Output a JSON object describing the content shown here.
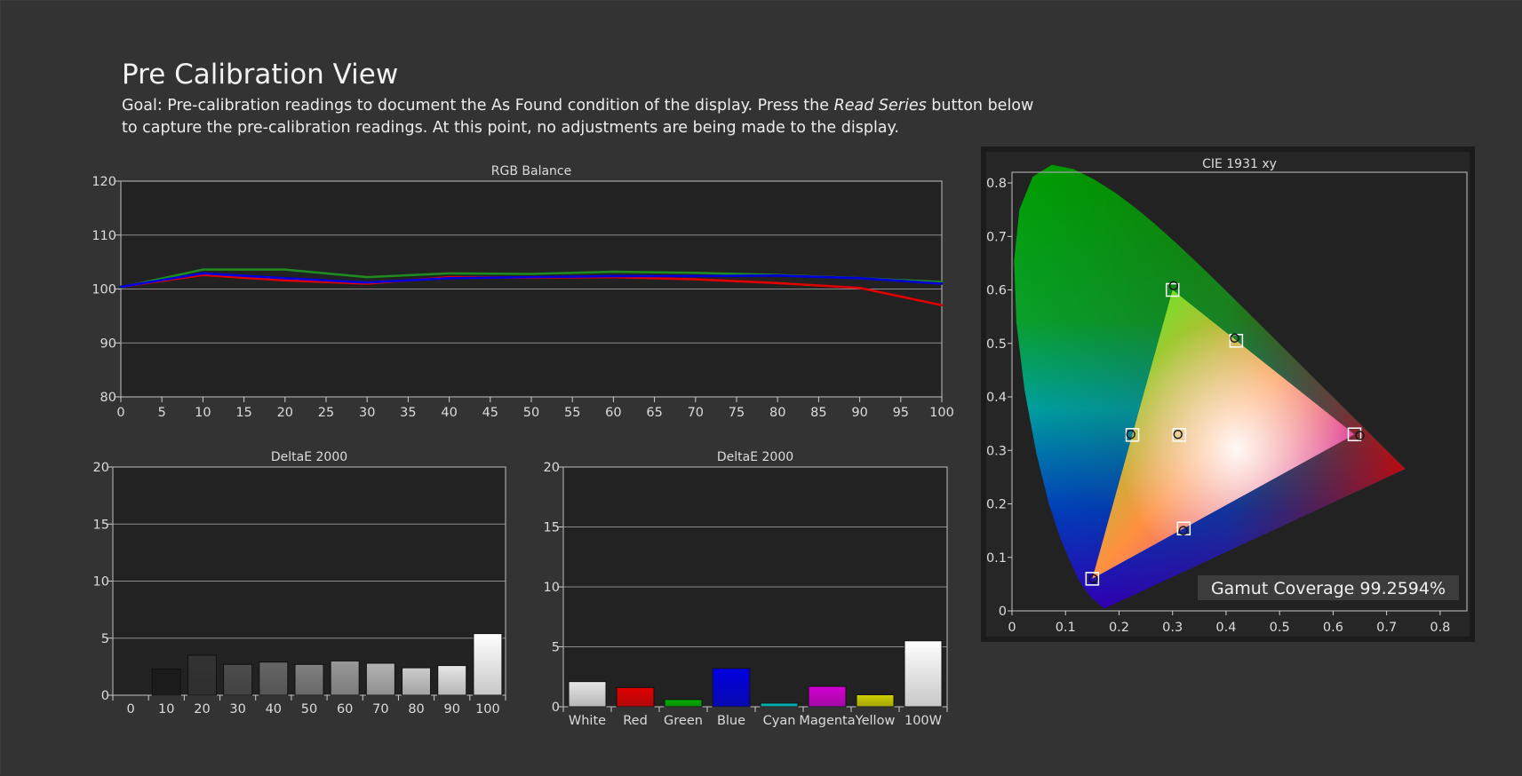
{
  "header": {
    "title": "Pre Calibration View",
    "goal_pre": "Goal: Pre-calibration readings to document the As Found condition of the display. Press the ",
    "goal_button": "Read Series",
    "goal_post": " button below to capture the pre-calibration readings. At this point, no adjustments are being made to the display."
  },
  "colors": {
    "background": "#333333",
    "plot_bg": "#222222",
    "grid": "#8c8c8c",
    "red": "#e00000",
    "green": "#1e8c1e",
    "blue": "#0000dc"
  },
  "chart_data": [
    {
      "id": "rgb_balance",
      "type": "line",
      "title": "RGB Balance",
      "xlabel": "",
      "ylabel": "",
      "x": [
        0,
        10,
        20,
        30,
        40,
        50,
        60,
        70,
        80,
        90,
        100
      ],
      "xlim": [
        0,
        100
      ],
      "ylim": [
        80,
        120
      ],
      "xticks": [
        0,
        5,
        10,
        15,
        20,
        25,
        30,
        35,
        40,
        45,
        50,
        55,
        60,
        65,
        70,
        75,
        80,
        85,
        90,
        95,
        100
      ],
      "yticks": [
        80,
        90,
        100,
        110,
        120
      ],
      "grid": true,
      "series": [
        {
          "color": "#1e8c1e",
          "values": [
            100.3,
            103.6,
            103.6,
            102.2,
            102.9,
            102.8,
            103.2,
            103.0,
            102.6,
            102.0,
            101.3
          ]
        },
        {
          "color": "#e00000",
          "values": [
            100.4,
            102.6,
            101.6,
            101.0,
            102.2,
            102.1,
            102.2,
            101.8,
            101.1,
            100.2,
            97.0
          ]
        },
        {
          "color": "#0000dc",
          "values": [
            100.4,
            102.9,
            102.0,
            101.2,
            102.0,
            102.2,
            102.4,
            102.4,
            102.5,
            102.0,
            101.0
          ]
        }
      ]
    },
    {
      "id": "delta_e_grayscale",
      "type": "bar",
      "title": "DeltaE 2000",
      "categories": [
        "0",
        "10",
        "20",
        "30",
        "40",
        "50",
        "60",
        "70",
        "80",
        "90",
        "100"
      ],
      "values": [
        0,
        2.3,
        3.5,
        2.7,
        2.9,
        2.7,
        3.0,
        2.8,
        2.4,
        2.6,
        5.4
      ],
      "colors": [
        "#000000",
        "#1a1a1a",
        "#333333",
        "#4d4d4d",
        "#666666",
        "#808080",
        "#999999",
        "#b3b3b3",
        "#cccccc",
        "#e6e6e6",
        "#ffffff"
      ],
      "ylim": [
        0,
        20
      ],
      "yticks": [
        0,
        5,
        10,
        15,
        20
      ],
      "grid": true
    },
    {
      "id": "delta_e_colors",
      "type": "bar",
      "title": "DeltaE 2000",
      "categories": [
        "White",
        "Red",
        "Green",
        "Blue",
        "Cyan",
        "Magenta",
        "Yellow",
        "100W"
      ],
      "values": [
        2.1,
        1.6,
        0.6,
        3.2,
        0.3,
        1.7,
        1.0,
        5.5
      ],
      "colors": [
        "#e6e6e6",
        "#e00000",
        "#00b000",
        "#0000e0",
        "#00c0c0",
        "#d000d0",
        "#d0d000",
        "#ffffff"
      ],
      "ylim": [
        0,
        20
      ],
      "yticks": [
        0,
        5,
        10,
        15,
        20
      ],
      "grid": true
    },
    {
      "id": "cie_1931",
      "type": "scatter",
      "title": "CIE 1931 xy",
      "xlim": [
        0,
        0.85
      ],
      "ylim": [
        0,
        0.82
      ],
      "xticks": [
        0,
        0.1,
        0.2,
        0.3,
        0.4,
        0.5,
        0.6,
        0.7,
        0.8
      ],
      "yticks": [
        0,
        0.1,
        0.2,
        0.3,
        0.4,
        0.5,
        0.6,
        0.7,
        0.8
      ],
      "gamut_coverage_label": "Gamut Coverage 99.2594%",
      "targets": [
        {
          "name": "Red",
          "x": 0.64,
          "y": 0.33
        },
        {
          "name": "Green",
          "x": 0.3,
          "y": 0.6
        },
        {
          "name": "Blue",
          "x": 0.15,
          "y": 0.06
        },
        {
          "name": "White",
          "x": 0.3127,
          "y": 0.329
        },
        {
          "name": "Cyan",
          "x": 0.225,
          "y": 0.329
        },
        {
          "name": "Magenta",
          "x": 0.321,
          "y": 0.154
        },
        {
          "name": "Yellow",
          "x": 0.419,
          "y": 0.505
        }
      ],
      "measured": [
        {
          "name": "Red",
          "x": 0.65,
          "y": 0.328
        },
        {
          "name": "Green",
          "x": 0.302,
          "y": 0.608
        },
        {
          "name": "Blue",
          "x": 0.152,
          "y": 0.06
        },
        {
          "name": "White",
          "x": 0.31,
          "y": 0.33
        },
        {
          "name": "Cyan",
          "x": 0.222,
          "y": 0.33
        },
        {
          "name": "Magenta",
          "x": 0.32,
          "y": 0.15
        },
        {
          "name": "Yellow",
          "x": 0.416,
          "y": 0.51
        }
      ]
    }
  ]
}
